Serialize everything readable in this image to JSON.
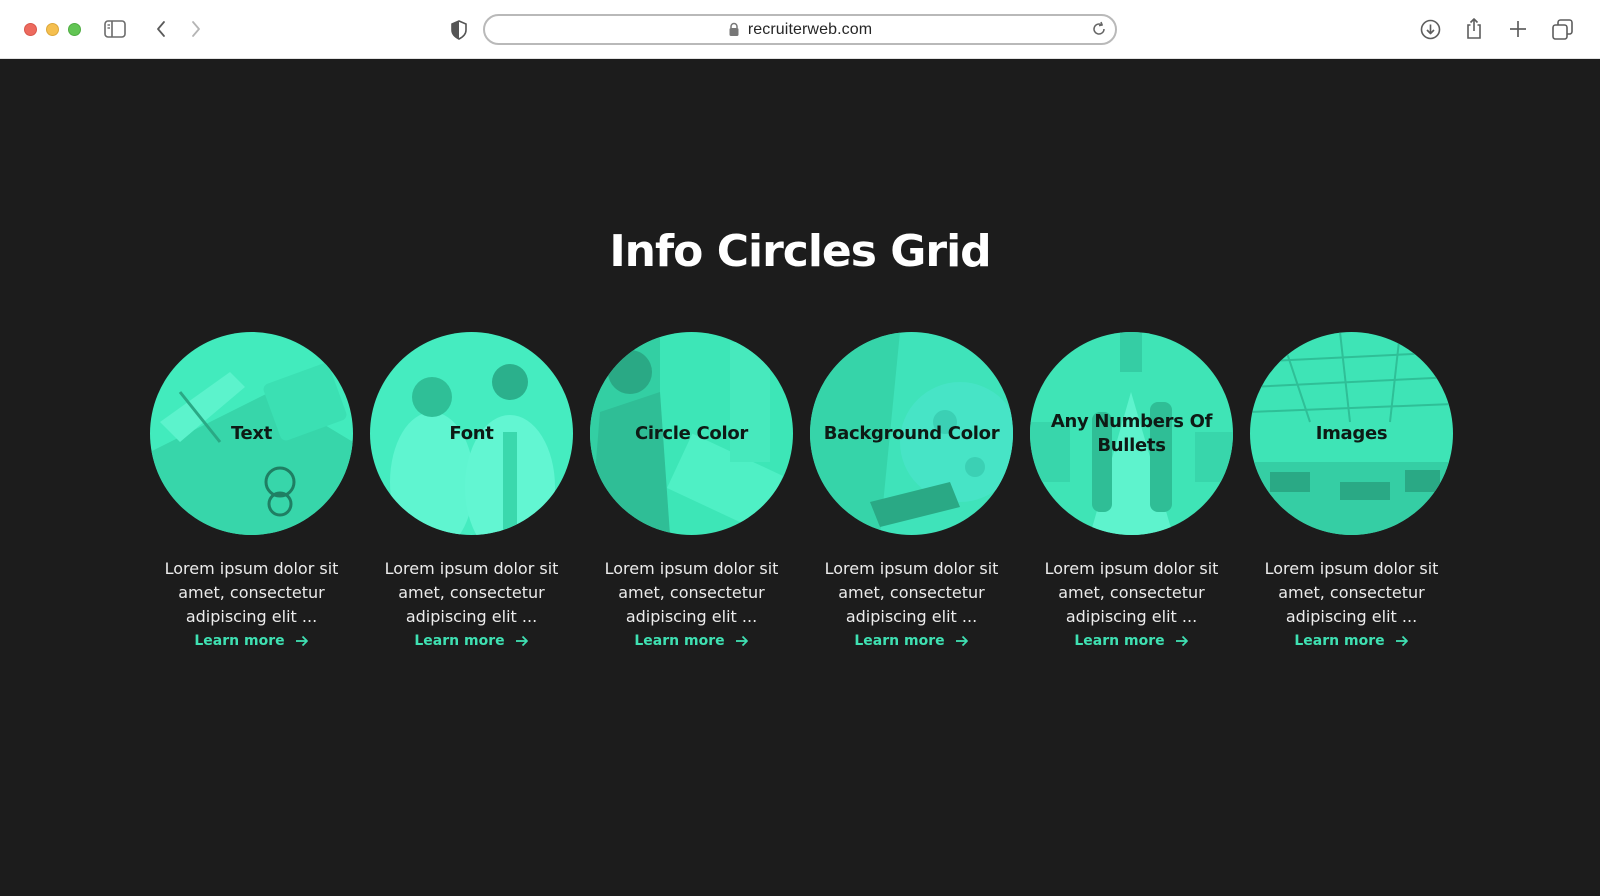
{
  "browser": {
    "url": "recruiterweb.com",
    "icons": [
      "sidebar-icon",
      "back-icon",
      "forward-icon",
      "privacy-shield-icon",
      "lock-icon",
      "reload-icon",
      "download-icon",
      "share-icon",
      "new-tab-icon",
      "tab-overview-icon"
    ]
  },
  "page": {
    "heading": "Info Circles Grid",
    "cards": [
      {
        "title": "Text",
        "description": "Lorem ipsum dolor sit amet, consectetur adipiscing elit ...",
        "link": "Learn more"
      },
      {
        "title": "Font",
        "description": "Lorem ipsum dolor sit amet, consectetur adipiscing elit ...",
        "link": "Learn more"
      },
      {
        "title": "Circle Color",
        "description": "Lorem ipsum dolor sit amet, consectetur adipiscing elit ...",
        "link": "Learn more"
      },
      {
        "title": "Background Color",
        "description": "Lorem ipsum dolor sit amet, consectetur adipiscing elit ...",
        "link": "Learn more"
      },
      {
        "title": "Any Numbers Of Bullets",
        "description": "Lorem ipsum dolor sit amet, consectetur adipiscing elit ...",
        "link": "Learn more"
      },
      {
        "title": "Images",
        "description": "Lorem ipsum dolor sit amet, consectetur adipiscing elit ...",
        "link": "Learn more"
      }
    ]
  },
  "colors": {
    "page_background": "#1c1c1c",
    "circle_tint": "#3fe8b8",
    "accent": "#3fe0b2",
    "heading": "#ffffff",
    "body_text": "#ececec"
  }
}
